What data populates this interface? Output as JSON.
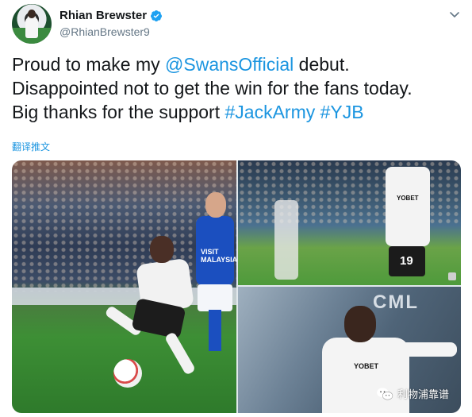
{
  "author": {
    "display_name": "Rhian Brewster",
    "handle": "@RhianBrewster9",
    "verified_icon": "verified-badge-icon",
    "avatar_icon": "avatar-image"
  },
  "tweet": {
    "line1_prefix": "Proud to make my ",
    "line1_mention": "@SwansOfficial",
    "line1_suffix": " debut.",
    "line2": "Disappointed not to get the win for the fans today.",
    "line3_prefix": "Big thanks for the support ",
    "hashtag1": "#JackArmy",
    "hashtag2": "#YJB",
    "translate_label": "翻译推文"
  },
  "media": {
    "photo1": {
      "board_text": "VISIT MALAYSIA"
    },
    "photo2": {
      "shirt_number": "19",
      "shirt_sponsor": "YOBET"
    },
    "photo3": {
      "shirt_sponsor": "YOBET",
      "background_sign": "CML"
    }
  },
  "watermark": {
    "label": "利物浦靠谱",
    "icon": "wechat-icon"
  },
  "colors": {
    "link": "#1b95e0",
    "text": "#14171a",
    "secondary": "#657786"
  }
}
